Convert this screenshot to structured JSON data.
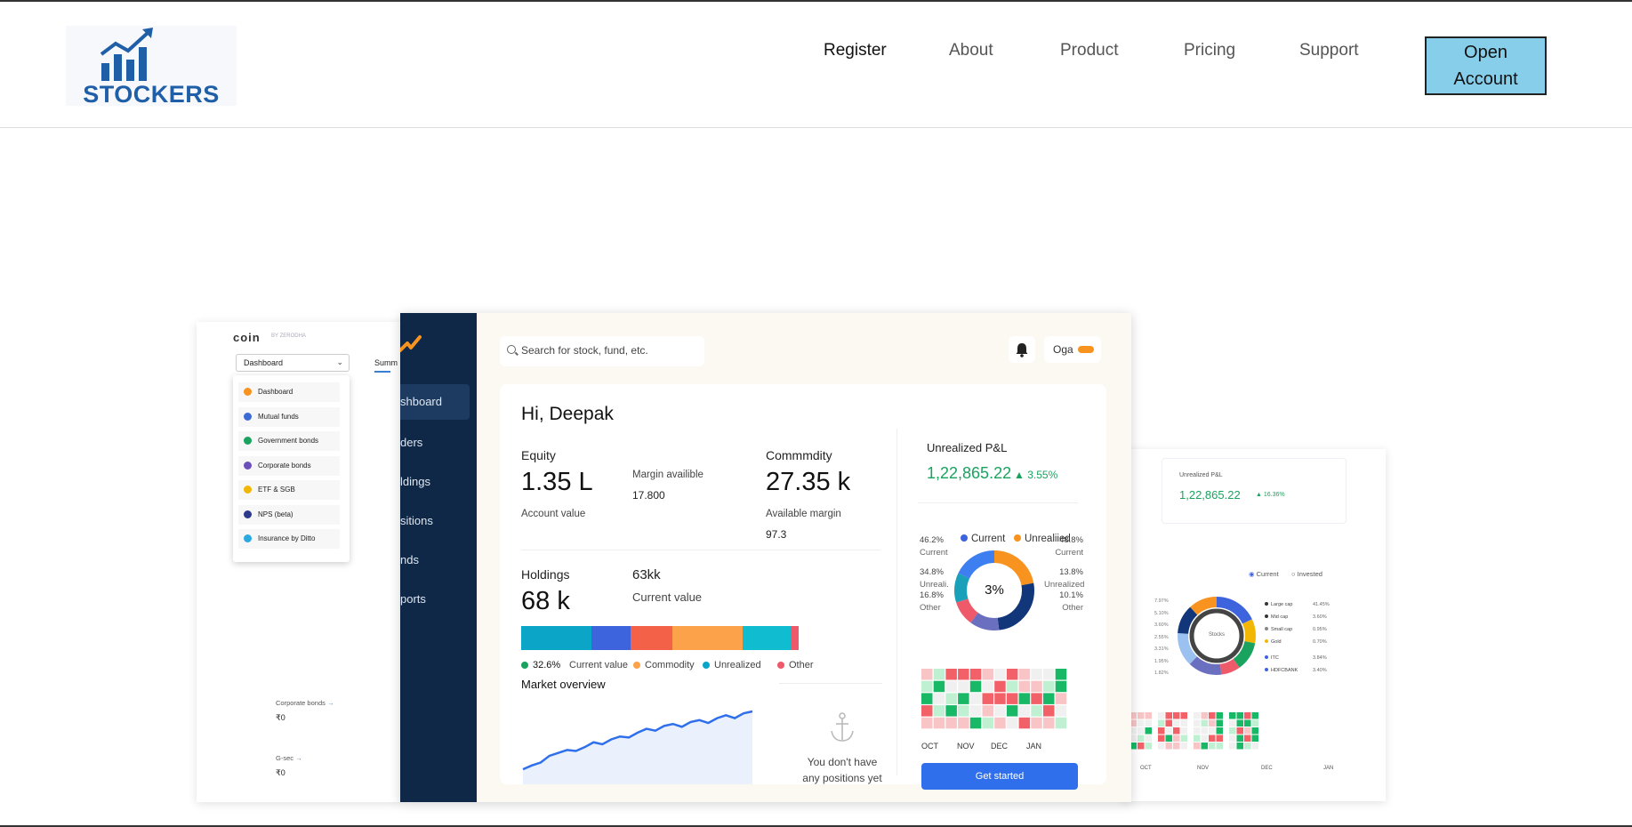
{
  "brand": {
    "logo_text": "STOCKERS",
    "accent": "#1f5fa8"
  },
  "nav": {
    "links": [
      "Register",
      "About",
      "Product",
      "Pricing",
      "Support"
    ],
    "open_account_line1": "Open",
    "open_account_line2": "Account",
    "button_color": "#87ceeb"
  },
  "coin_screen": {
    "logo": "coin",
    "logo_sub": "BY ZERODHA",
    "dropdown_value": "Dashboard",
    "tab": "Summ",
    "menu": [
      "Dashboard",
      "Mutual funds",
      "Government bonds",
      "Corporate bonds",
      "ETF & SGB",
      "NPS (beta)",
      "Insurance by Ditto"
    ],
    "menu_icon_colors": [
      "#f7931e",
      "#3c6bd6",
      "#1aa35f",
      "#6b4fbb",
      "#f2b705",
      "#2d3a8c",
      "#2aa9e0"
    ],
    "footer": [
      {
        "label": "Corporate bonds",
        "value": "₹0"
      },
      {
        "label": "G-sec",
        "value": "₹0"
      }
    ]
  },
  "dashboard": {
    "sidebar": [
      "shboard",
      "ders",
      "ldings",
      "sitions",
      "nds",
      "ports"
    ],
    "search_placeholder": "Search for stock, fund, etc.",
    "user_name": "Oga",
    "greeting": "Hi, Deepak",
    "equity": {
      "label": "Equity",
      "value": "1.35 L",
      "sub": "Account value",
      "margin_label": "Margin availible",
      "margin_value": "17.800"
    },
    "commodity": {
      "label": "Commmdity",
      "value": "27.35 k",
      "sub": "Available margin",
      "sub_value": "97.3"
    },
    "holdings": {
      "label": "Holdings",
      "value": "68 k",
      "side_value": "63kk",
      "side_label": "Current value"
    },
    "allocation_bar": [
      {
        "color": "#0aa5c7",
        "share": 22
      },
      {
        "color": "#3d63dd",
        "share": 12
      },
      {
        "color": "#f26148",
        "share": 13
      },
      {
        "color": "#fba24a",
        "share": 22
      },
      {
        "color": "#10bccf",
        "share": 15
      },
      {
        "color": "#ef5a6b",
        "share": 2.5
      }
    ],
    "legend": [
      {
        "label": "32.6%",
        "color": "#1aa35f"
      },
      {
        "label": "Current value",
        "color": ""
      },
      {
        "label": "Commodity",
        "color": "#fba24a"
      },
      {
        "label": "Unrealized",
        "color": "#0aa5c7"
      },
      {
        "label": "Other",
        "color": "#ef5a6b"
      }
    ],
    "market_overview": "Market overview",
    "market_series": [
      10,
      14,
      17,
      24,
      27,
      30,
      29,
      33,
      38,
      36,
      41,
      44,
      43,
      48,
      52,
      50,
      55,
      57,
      54,
      59,
      61,
      58,
      63,
      66,
      63,
      68,
      70
    ],
    "no_positions_line1": "You don't have",
    "no_positions_line2": "any positions yet",
    "pnl": {
      "label": "Unrealized P&L",
      "value": "1,22,865.22",
      "pct": "▲ 3.55%"
    },
    "donut": {
      "legend": [
        "Current",
        "Unrealiied"
      ],
      "legend_colors": [
        "#3d63dd",
        "#f7931e"
      ],
      "center": "3%",
      "segments": [
        {
          "color": "#f7931e",
          "share": 22
        },
        {
          "color": "#12367a",
          "share": 26
        },
        {
          "color": "#6b6fbf",
          "share": 12
        },
        {
          "color": "#ef5a6b",
          "share": 10
        },
        {
          "color": "#1aa0b8",
          "share": 12
        },
        {
          "color": "#3d7ff0",
          "share": 18
        }
      ],
      "left_labels": [
        {
          "pct": "46.2%",
          "name": "Current"
        },
        {
          "pct": "34.8%",
          "name": "Unreali."
        },
        {
          "pct": "16.8%",
          "name": "Other"
        }
      ],
      "right_labels": [
        {
          "pct": "48.8%",
          "name": "Current"
        },
        {
          "pct": "13.8%",
          "name": "Unrealized"
        },
        {
          "pct": "10.1%",
          "name": "Other"
        }
      ]
    },
    "heatmap_months": [
      "OCT",
      "NOV",
      "DEC",
      "JAN"
    ],
    "heatmap_colors": {
      "green": "#18b866",
      "red": "#f26168",
      "light_red": "#f8c4c6",
      "light_green": "#bff0d2",
      "empty": "#f0f0f0"
    },
    "get_started": "Get started"
  },
  "right_screen": {
    "pnl_label": "Unrealized P&L",
    "pnl_value": "1,22,865.22",
    "pnl_pct": "▲ 16.36%",
    "legend": [
      "Current",
      "Invested"
    ],
    "donut_center": "Stocks",
    "left_nums": [
      "7.97%",
      "5.10%",
      "3.60%",
      "2.55%",
      "3.31%",
      "1.95%",
      "1.82%"
    ],
    "rows": [
      {
        "name": "Large cap",
        "value": "41.45%",
        "color": "#333"
      },
      {
        "name": "Mid cap",
        "value": "3.60%",
        "color": "#333"
      },
      {
        "name": "Small cap",
        "value": "0.95%",
        "color": "#888"
      },
      {
        "name": "Gold",
        "value": "0.70%",
        "color": "#f2b705"
      },
      {
        "name": "ITC",
        "value": "3.84%",
        "color": "#3d63dd"
      },
      {
        "name": "HDFCBANK",
        "value": "3.40%",
        "color": "#3d63dd"
      }
    ],
    "months": [
      "OCT",
      "NOV",
      "DEC",
      "JAN"
    ]
  }
}
